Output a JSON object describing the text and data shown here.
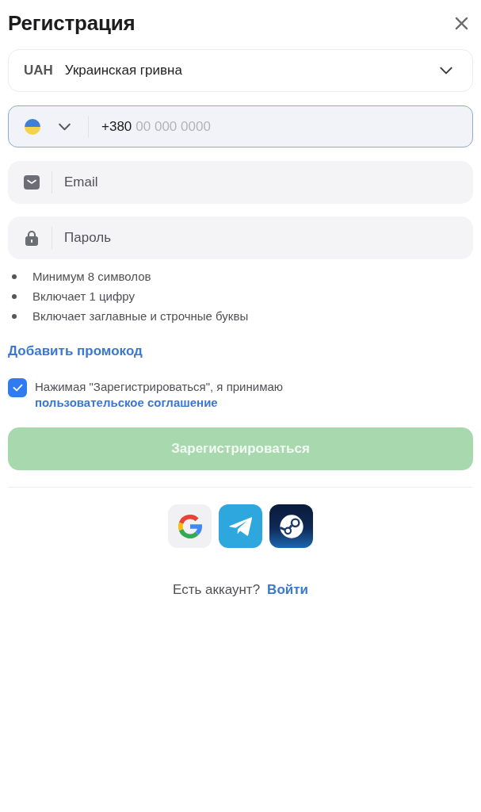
{
  "header": {
    "title": "Регистрация"
  },
  "currency": {
    "code": "UAH",
    "name": "Украинская гривна"
  },
  "phone": {
    "prefix": "+380",
    "placeholder": "00 000 0000",
    "focused": true
  },
  "email": {
    "placeholder": "Email"
  },
  "password": {
    "placeholder": "Пароль"
  },
  "password_rules": [
    "Минимум 8 символов",
    "Включает 1 цифру",
    "Включает заглавные и строчные буквы"
  ],
  "promo_link": "Добавить промокод",
  "agreement": {
    "checked": true,
    "text": "Нажимая \"Зарегистрироваться\", я принимаю",
    "link": "пользовательское соглашение"
  },
  "submit": {
    "label": "Зарегистрироваться",
    "disabled": true
  },
  "social_logins": [
    {
      "kind": "google"
    },
    {
      "kind": "telegram"
    },
    {
      "kind": "steam"
    }
  ],
  "footer": {
    "text": "Есть аккаунт?",
    "link": "Войти"
  }
}
